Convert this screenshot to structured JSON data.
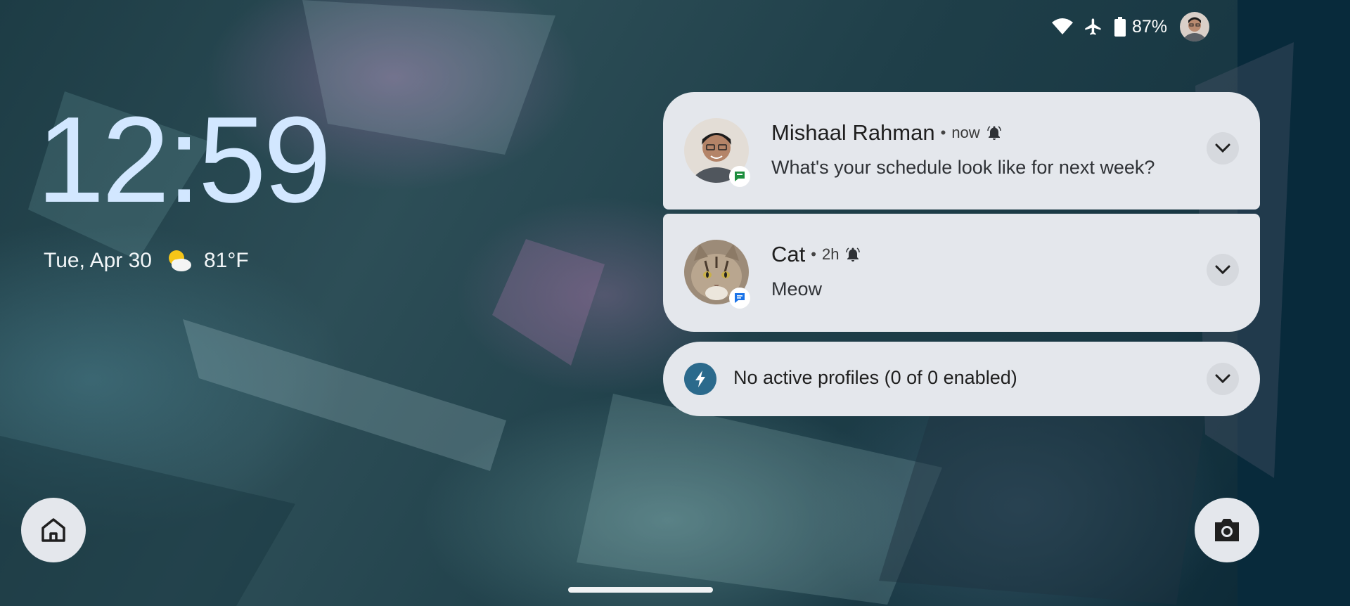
{
  "status_bar": {
    "wifi_icon": "wifi-icon",
    "airplane_icon": "airplane-icon",
    "battery_icon": "battery-icon",
    "battery": "87%",
    "avatar": "user-avatar"
  },
  "lockscreen": {
    "time": "12:59",
    "date": "Tue, Apr 30",
    "weather_icon": "partly-cloudy-icon",
    "temperature": "81°F"
  },
  "notifications": [
    {
      "name": "Mishaal Rahman",
      "separator": "•",
      "time": "now",
      "message": "What's your schedule look like for next week?",
      "badge_icon": "chat-icon",
      "badge_color": "#1e8e3e"
    },
    {
      "name": "Cat",
      "separator": "•",
      "time": "2h",
      "message": "Meow",
      "badge_icon": "message-icon",
      "badge_color": "#1a73e8"
    }
  ],
  "profiles": {
    "text": "No active profiles (0 of 0 enabled)",
    "icon": "bolt-icon",
    "icon_color": "#2b6a8c"
  },
  "shortcuts": {
    "home_icon": "home-icon",
    "camera_icon": "camera-icon"
  }
}
